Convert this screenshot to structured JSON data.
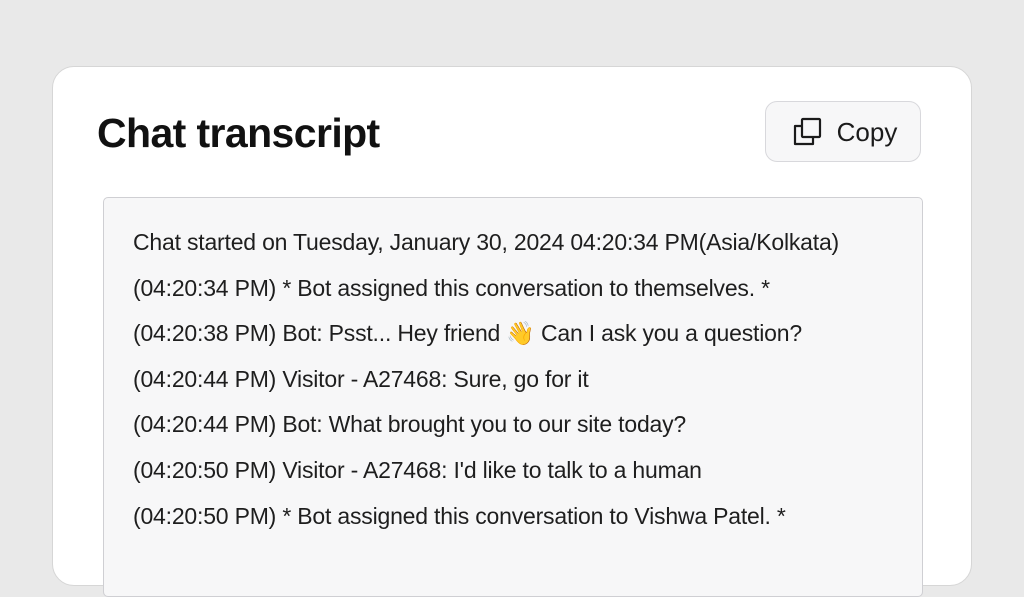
{
  "header": {
    "title": "Chat transcript",
    "copy_label": "Copy",
    "copy_icon": "copy-icon"
  },
  "transcript": {
    "lines": [
      "Chat started on Tuesday, January 30, 2024 04:20:34 PM(Asia/Kolkata)",
      "(04:20:34 PM) * Bot assigned this conversation to themselves. *",
      "(04:20:38 PM) Bot: Psst... Hey friend 👋 Can I ask you a question?",
      "(04:20:44 PM) Visitor - A27468: Sure, go for it",
      "(04:20:44 PM) Bot: What brought you to our site today?",
      "(04:20:50 PM) Visitor - A27468: I'd like to talk to a human",
      "(04:20:50 PM) * Bot assigned this conversation to Vishwa Patel. *"
    ]
  },
  "colors": {
    "page_background": "#e9e9e9",
    "card_background": "#ffffff",
    "transcript_background": "#f7f7f8"
  }
}
